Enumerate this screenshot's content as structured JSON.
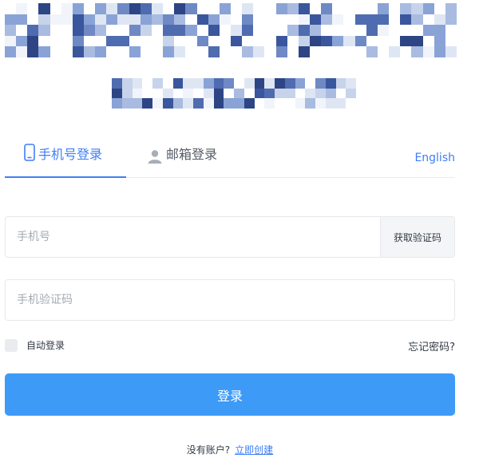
{
  "tabs": {
    "phone_label": "手机号登录",
    "email_label": "邮箱登录",
    "language_link": "English"
  },
  "form": {
    "phone_placeholder": "手机号",
    "get_code_label": "获取验证码",
    "code_placeholder": "手机验证码",
    "remember_label": "自动登录",
    "forgot_label": "忘记密码?",
    "login_label": "登录"
  },
  "footer": {
    "no_account_text": "没有账户?",
    "register_link": "立即创建"
  },
  "colors": {
    "accent": "#3e7ef6",
    "login_button": "#3d9af7",
    "border": "#e6e8ec",
    "placeholder": "#a5abb4"
  },
  "icons": {
    "phone_tab": "mobile-phone-icon",
    "email_tab": "user-icon"
  }
}
